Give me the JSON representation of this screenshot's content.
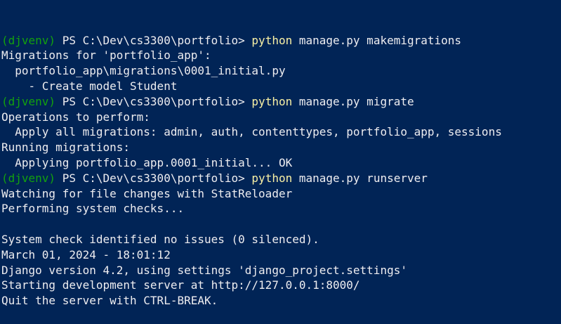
{
  "colors": {
    "background": "#012456",
    "text": "#eeedf0",
    "venv": "#13a10e",
    "command": "#f9f1a5"
  },
  "terminal": {
    "lines": [
      {
        "type": "prompt",
        "venv": "(djvenv)",
        "ps": " PS C:\\Dev\\cs3300\\portfolio> ",
        "cmd": "python",
        "args": " manage.py makemigrations"
      },
      {
        "type": "text",
        "text": "Migrations for 'portfolio_app':"
      },
      {
        "type": "text",
        "text": "  portfolio_app\\migrations\\0001_initial.py"
      },
      {
        "type": "text",
        "text": "    - Create model Student"
      },
      {
        "type": "prompt",
        "venv": "(djvenv)",
        "ps": " PS C:\\Dev\\cs3300\\portfolio> ",
        "cmd": "python",
        "args": " manage.py migrate"
      },
      {
        "type": "text",
        "text": "Operations to perform:"
      },
      {
        "type": "text",
        "text": "  Apply all migrations: admin, auth, contenttypes, portfolio_app, sessions"
      },
      {
        "type": "text",
        "text": "Running migrations:"
      },
      {
        "type": "text",
        "text": "  Applying portfolio_app.0001_initial... OK"
      },
      {
        "type": "prompt",
        "venv": "(djvenv)",
        "ps": " PS C:\\Dev\\cs3300\\portfolio> ",
        "cmd": "python",
        "args": " manage.py runserver"
      },
      {
        "type": "text",
        "text": "Watching for file changes with StatReloader"
      },
      {
        "type": "text",
        "text": "Performing system checks..."
      },
      {
        "type": "text",
        "text": ""
      },
      {
        "type": "text",
        "text": "System check identified no issues (0 silenced)."
      },
      {
        "type": "text",
        "text": "March 01, 2024 - 18:01:12"
      },
      {
        "type": "text",
        "text": "Django version 4.2, using settings 'django_project.settings'"
      },
      {
        "type": "text",
        "text": "Starting development server at http://127.0.0.1:8000/"
      },
      {
        "type": "text",
        "text": "Quit the server with CTRL-BREAK."
      }
    ]
  }
}
